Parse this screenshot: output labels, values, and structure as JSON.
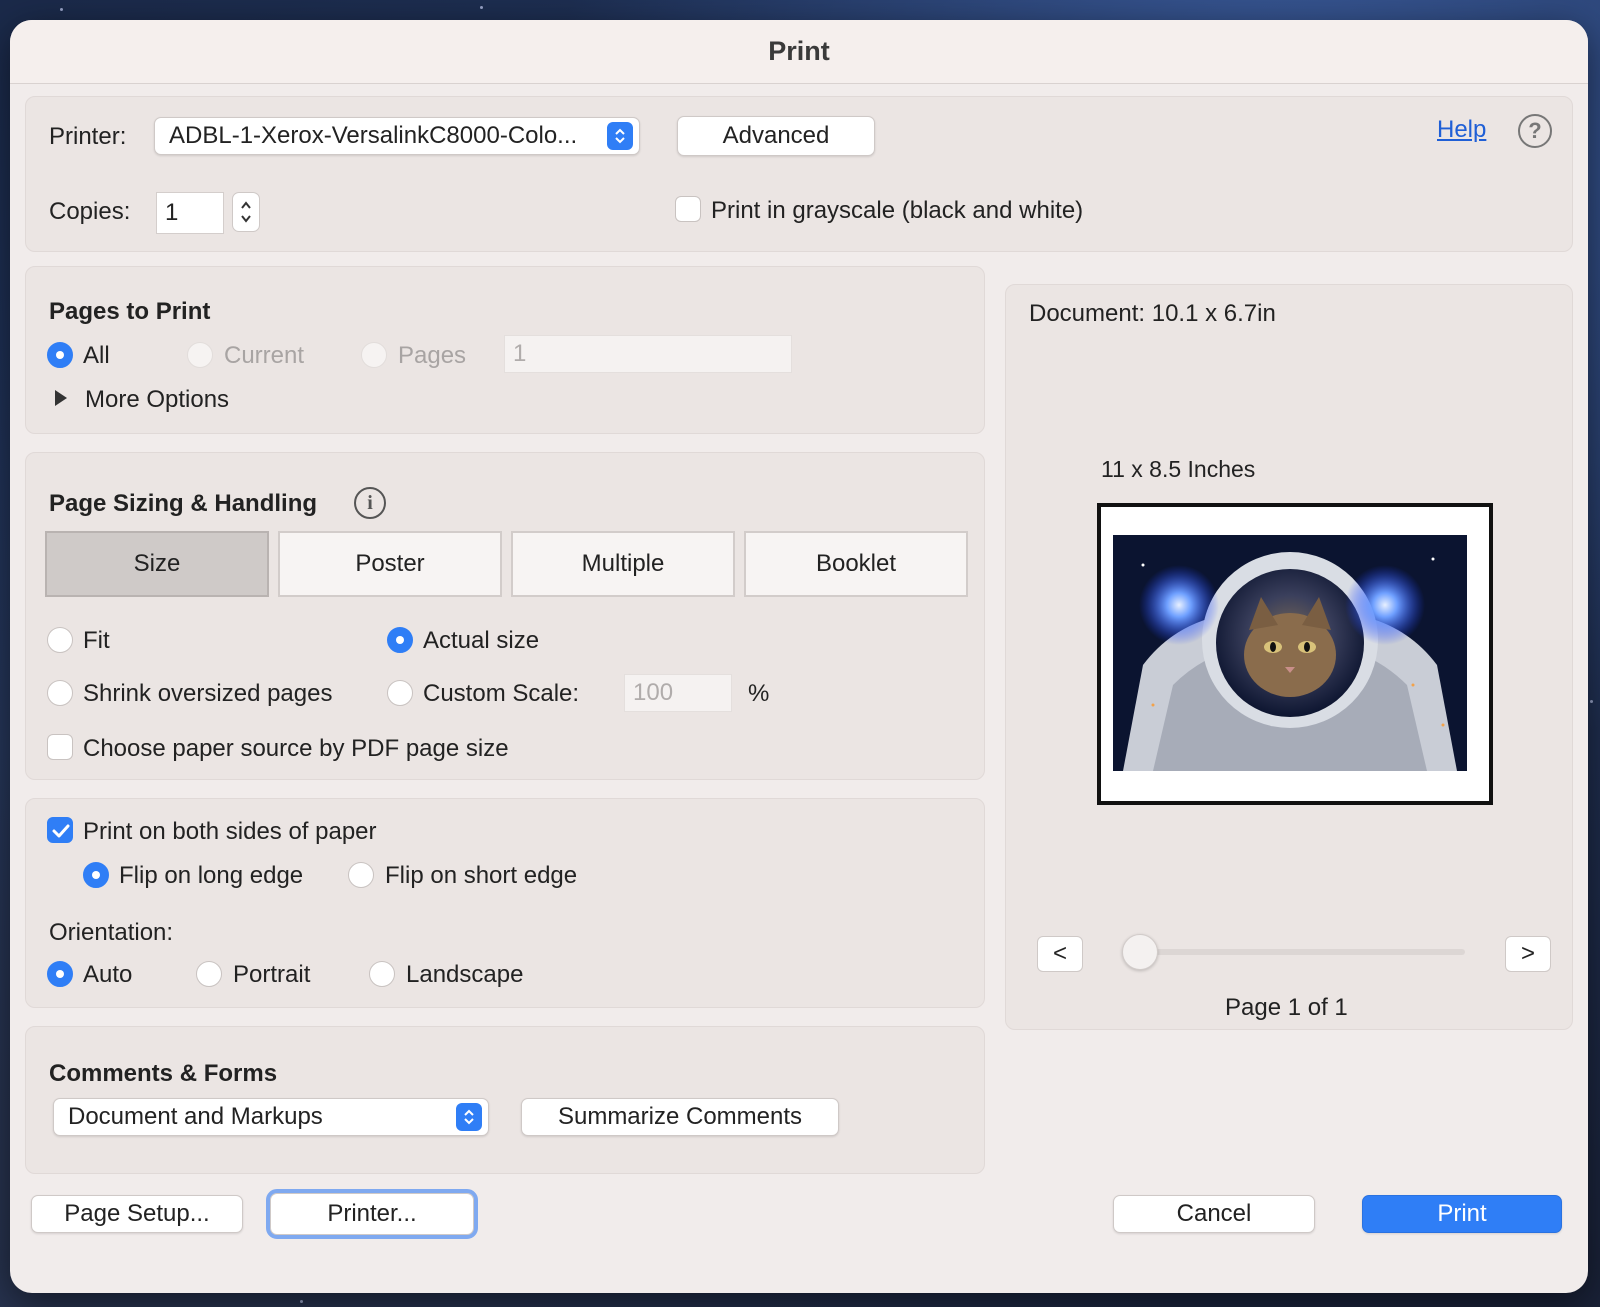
{
  "dialog": {
    "title": "Print"
  },
  "printer": {
    "label": "Printer:",
    "selected": "ADBL-1-Xerox-VersalinkC8000-Colo...",
    "advanced_label": "Advanced",
    "help_label": "Help",
    "copies_label": "Copies:",
    "copies_value": "1",
    "grayscale_label": "Print in grayscale (black and white)",
    "grayscale_checked": false
  },
  "pages_to_print": {
    "heading": "Pages to Print",
    "all_label": "All",
    "current_label": "Current",
    "pages_label": "Pages",
    "pages_value": "1",
    "selected": "All",
    "more_options_label": "More Options"
  },
  "page_sizing": {
    "heading": "Page Sizing & Handling",
    "tabs": [
      "Size",
      "Poster",
      "Multiple",
      "Booklet"
    ],
    "selected_tab": "Size",
    "fit_label": "Fit",
    "actual_size_label": "Actual size",
    "shrink_label": "Shrink oversized pages",
    "custom_scale_label": "Custom Scale:",
    "custom_scale_value": "100",
    "percent_label": "%",
    "paper_source_label": "Choose paper source by PDF page size",
    "selected_option": "Actual size"
  },
  "duplex": {
    "both_sides_label": "Print on both sides of paper",
    "both_sides_checked": true,
    "long_edge_label": "Flip on long edge",
    "short_edge_label": "Flip on short edge",
    "selected_flip": "Flip on long edge",
    "orientation_label": "Orientation:",
    "auto_label": "Auto",
    "portrait_label": "Portrait",
    "landscape_label": "Landscape",
    "selected_orientation": "Auto"
  },
  "comments_forms": {
    "heading": "Comments & Forms",
    "selected": "Document and Markups",
    "summarize_label": "Summarize Comments"
  },
  "preview": {
    "document_size": "Document: 10.1 x 6.7in",
    "paper_size": "11 x 8.5 Inches",
    "prev_label": "<",
    "next_label": ">",
    "page_indicator": "Page 1 of 1",
    "slider_position": 0
  },
  "footer": {
    "page_setup_label": "Page Setup...",
    "printer_label": "Printer...",
    "cancel_label": "Cancel",
    "print_label": "Print"
  },
  "colors": {
    "accent": "#2f7ef6",
    "dialog_bg": "#f1eceb",
    "panel_bg": "#ebe5e3"
  }
}
